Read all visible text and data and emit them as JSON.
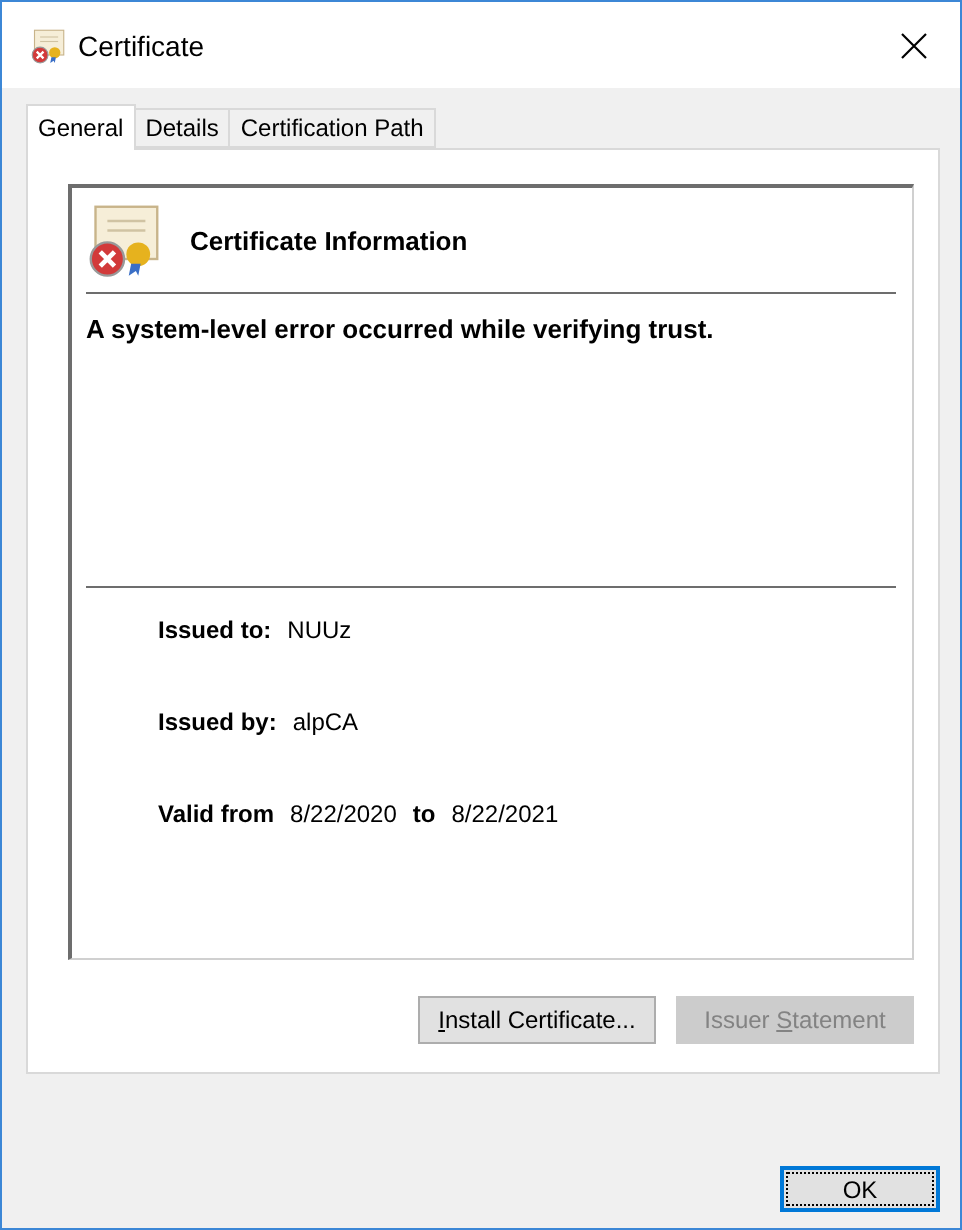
{
  "window": {
    "title": "Certificate"
  },
  "tabs": [
    {
      "label": "General",
      "selected": true
    },
    {
      "label": "Details",
      "selected": false
    },
    {
      "label": "Certification Path",
      "selected": false
    }
  ],
  "info": {
    "heading": "Certificate Information",
    "message": "A system-level error occurred while verifying trust.",
    "issued_to": {
      "label": "Issued to:",
      "value": "NUUz"
    },
    "issued_by": {
      "label": "Issued by:",
      "value": "alpCA"
    },
    "valid": {
      "label": "Valid from",
      "from": "8/22/2020",
      "to_label": "to",
      "to": "8/22/2021"
    }
  },
  "panel_buttons": [
    {
      "key": "I",
      "after": "nstall Certificate...",
      "disabled": false
    },
    {
      "before": "Issuer ",
      "key": "S",
      "after": "tatement",
      "disabled": true
    }
  ],
  "ok_button": {
    "label": "OK",
    "focused": true
  }
}
